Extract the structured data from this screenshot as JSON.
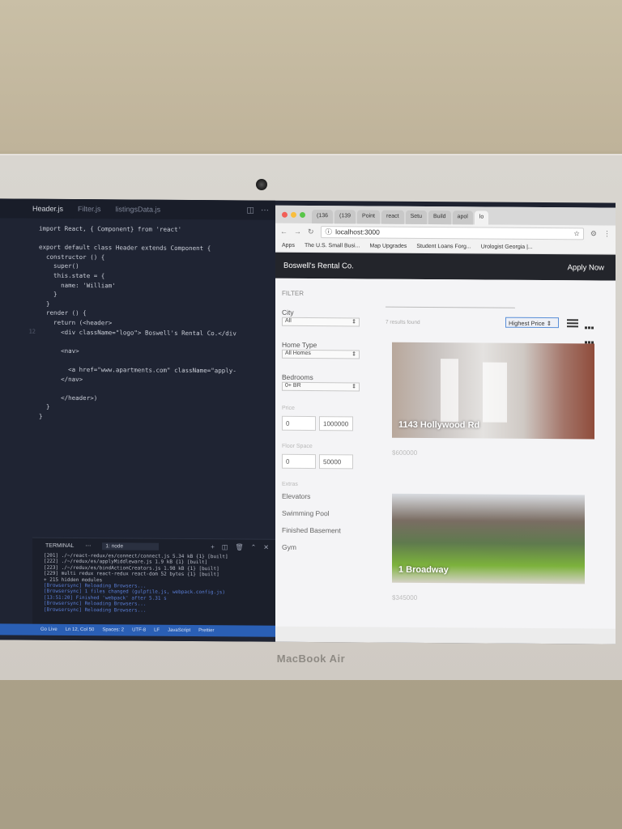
{
  "device": {
    "brand": "MacBook Air"
  },
  "editor": {
    "tabs": [
      {
        "label": "Header.js",
        "active": true
      },
      {
        "label": "Filter.js",
        "active": false
      },
      {
        "label": "listingsData.js",
        "active": false
      }
    ],
    "code_lines": [
      {
        "num": "",
        "text": "import React, { Component} from 'react'"
      },
      {
        "num": "",
        "text": ""
      },
      {
        "num": "",
        "text": "export default class Header extends Component {"
      },
      {
        "num": "",
        "text": "  constructor () {"
      },
      {
        "num": "",
        "text": "    super()"
      },
      {
        "num": "",
        "text": "    this.state = {"
      },
      {
        "num": "",
        "text": "      name: 'William'"
      },
      {
        "num": "",
        "text": "    }"
      },
      {
        "num": "",
        "text": "  }"
      },
      {
        "num": "",
        "text": "  render () {"
      },
      {
        "num": "",
        "text": "    return (<header>"
      },
      {
        "num": "12",
        "text": "      <div className=\"logo\"> Boswell's Rental Co.</div"
      },
      {
        "num": "",
        "text": ""
      },
      {
        "num": "",
        "text": "      <nav>"
      },
      {
        "num": "",
        "text": ""
      },
      {
        "num": "",
        "text": "        <a href=\"www.apartments.com\" className=\"apply-"
      },
      {
        "num": "",
        "text": "      </nav>"
      },
      {
        "num": "",
        "text": ""
      },
      {
        "num": "",
        "text": "      </header>)"
      },
      {
        "num": "",
        "text": "  }"
      },
      {
        "num": "",
        "text": "}"
      }
    ],
    "terminal": {
      "title": "TERMINAL",
      "shell": "1: node",
      "lines": [
        "[201] ./~/react-redux/es/connect/connect.js 5.34 kB {1} [built]",
        "[222] ./~/redux/es/applyMiddleware.js 1.9 kB {1} [built]",
        "[223] ./~/redux/es/bindActionCreators.js 1.98 kB {1} [built]",
        "[229] multi redux react-redux react-dom 52 bytes {1} [built]",
        "    + 215 hidden modules",
        "[Browsersync] Reloading Browsers...",
        "[Browsersync] 1 files changed (gulpfile.js, webpack.config.js)",
        "[13:51:20] Finished 'webpack' after 5.31 s",
        "[Browsersync] Reloading Browsers...",
        "[Browsersync] Reloading Browsers..."
      ]
    },
    "status_bar": [
      "Go Live",
      "Ln 12, Col 50",
      "Spaces: 2",
      "UTF-8",
      "LF",
      "JavaScript",
      "Prettier"
    ]
  },
  "browser": {
    "tabs": [
      {
        "label": "(136"
      },
      {
        "label": "(139"
      },
      {
        "label": "Point"
      },
      {
        "label": "react"
      },
      {
        "label": "Setu"
      },
      {
        "label": "Build"
      },
      {
        "label": "apol"
      },
      {
        "label": "lo",
        "active": true
      }
    ],
    "url": "localhost:3000",
    "bookmarks": [
      "Apps",
      "The U.S. Small Busi...",
      "Map Upgrades",
      "Student Loans Forg...",
      "Urologist Georgia |..."
    ],
    "site": {
      "logo": "Boswell's Rental Co.",
      "apply": "Apply Now",
      "filter": {
        "title": "FILTER",
        "city_label": "City",
        "city_value": "All",
        "home_type_label": "Home Type",
        "home_type_value": "All Homes",
        "bedrooms_label": "Bedrooms",
        "bedrooms_value": "0+ BR",
        "price_label": "Price",
        "price_min": "0",
        "price_max": "1000000",
        "floor_label": "Floor Space",
        "floor_min": "0",
        "floor_max": "50000",
        "extras_label": "Extras",
        "extras": [
          "Elevators",
          "Swimming Pool",
          "Finished Basement",
          "Gym"
        ]
      },
      "results_text": "7 results found",
      "sort_value": "Highest Price",
      "listings": [
        {
          "address": "1143 Hollywood Rd",
          "price": "$600000"
        },
        {
          "address": "1 Broadway",
          "price": "$345000"
        }
      ]
    }
  }
}
